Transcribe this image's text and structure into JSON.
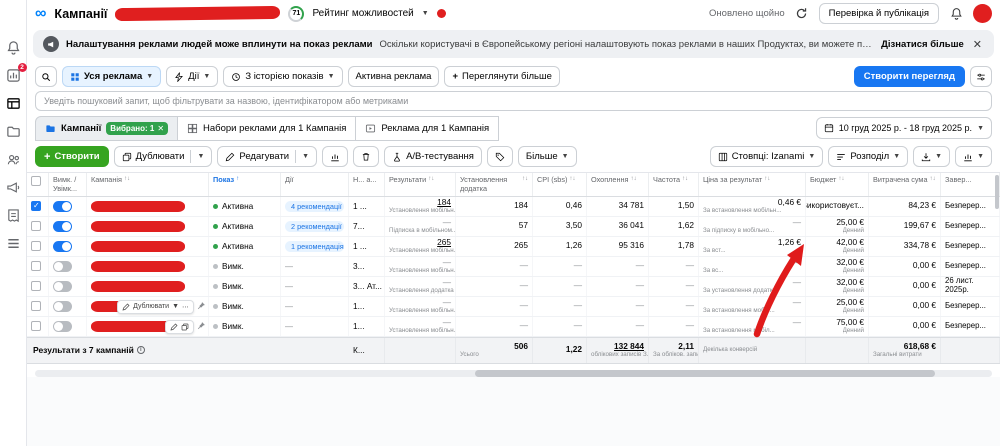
{
  "topbar": {
    "title": "Кампанії",
    "score": "71",
    "score_label": "Рейтинг можливостей",
    "updated": "Оновлено щойно",
    "review_button": "Перевірка й публікація"
  },
  "banner": {
    "title": "Налаштування реклами людей може вплинути на показ реклами",
    "text": "Оскільки користувачі в Європейському регіоні налаштовують показ реклами в наших Продуктах, ви можете помітити вплив на результативність, як-от зменшення охоплення. У деяких нов...",
    "link": "Дізнатися більше"
  },
  "filters": {
    "all_ads": "Уся реклама",
    "actions": "Дії",
    "history": "З історією показів",
    "active": "Активна реклама",
    "more": "Переглянути більше",
    "create_view": "Створити перегляд",
    "search_placeholder": "Уведіть пошуковий запит, щоб фільтрувати за назвою, ідентифікатором або метриками"
  },
  "tabs": {
    "campaigns": "Кампанії",
    "selected_badge": "Вибрано: 1",
    "adsets": "Набори реклами для 1 Кампанія",
    "ads": "Реклама для 1 Кампанія",
    "date_range": "10 груд 2025 р. - 18 груд 2025 р."
  },
  "toolbar": {
    "create": "Створити",
    "duplicate": "Дублювати",
    "edit": "Редагувати",
    "ab_test": "A/B-тестування",
    "more": "Більше",
    "columns": "Стовпці: Izanami",
    "breakdown": "Розподіл"
  },
  "row_tools": {
    "duplicate": "Дублювати"
  },
  "table": {
    "headers": {
      "off_on": "Вимк. / Увімк...",
      "campaign": "Кампанія",
      "delivery": "Показ",
      "actions": "Дії",
      "name_col": "Н... а...",
      "results": "Результати",
      "app_installs": "Установлення додатка",
      "cpi": "CPI (sbs)",
      "reach": "Охоплення",
      "frequency": "Частота",
      "cost_per_result": "Ціна за результат",
      "budget": "Бюджет",
      "amount_spent": "Витрачена сума",
      "ends": "Завер..."
    },
    "rows": [
      {
        "on": true,
        "checked": true,
        "status": "Активна",
        "rec": "4 рекомендації",
        "name_col": "1 ...",
        "result": "184",
        "result_sub": "Установлення мобільн...",
        "installs": "184",
        "cpi": "0,46",
        "reach": "34 781",
        "frequency": "1,50",
        "cost": "0,46 €",
        "cost_sub": "За встановлення мобільн...",
        "budget": "Використовуєт...",
        "budget_sub": "",
        "spent": "84,23 €",
        "ends": "Безперер..."
      },
      {
        "on": true,
        "checked": false,
        "status": "Активна",
        "rec": "2 рекомендації",
        "name_col": "7...",
        "result": "—",
        "result_sub": "Підписка в мобільном...",
        "installs": "57",
        "cpi": "3,50",
        "reach": "36 041",
        "frequency": "1,62",
        "cost": "—",
        "cost_sub": "За підписку в мобільно...",
        "budget": "25,00 €",
        "budget_sub": "Денний",
        "spent": "199,67 €",
        "ends": "Безперер..."
      },
      {
        "on": true,
        "checked": false,
        "status": "Активна",
        "rec": "1 рекомендація",
        "name_col": "1 ...",
        "result": "265",
        "result_sub": "Установлення мобільн...",
        "installs": "265",
        "cpi": "1,26",
        "reach": "95 316",
        "frequency": "1,78",
        "cost": "1,26 €",
        "cost_sub": "За вст...",
        "budget": "42,00 €",
        "budget_sub": "Денний",
        "spent": "334,78 €",
        "ends": "Безперер..."
      },
      {
        "on": false,
        "checked": false,
        "status": "Вимк.",
        "rec": "—",
        "name_col": "3...",
        "result": "—",
        "result_sub": "Установлення мобільн...",
        "installs": "—",
        "cpi": "—",
        "reach": "—",
        "frequency": "—",
        "cost": "—",
        "cost_sub": "За вс...",
        "budget": "32,00 €",
        "budget_sub": "Денний",
        "spent": "0,00 €",
        "ends": "Безперер..."
      },
      {
        "on": false,
        "checked": false,
        "status": "Вимк.",
        "rec": "—",
        "name_col": "3... Ат...",
        "result": "—",
        "result_sub": "Установлення додатка",
        "installs": "—",
        "cpi": "—",
        "reach": "—",
        "frequency": "—",
        "cost": "—",
        "cost_sub": "За установлення додатка",
        "budget": "32,00 €",
        "budget_sub": "Денний",
        "spent": "0,00 €",
        "ends": "26 лист. 2025р."
      },
      {
        "on": false,
        "checked": false,
        "status": "Вимк.",
        "rec": "—",
        "name_col": "1...",
        "result": "—",
        "result_sub": "Установлення мобільн...",
        "installs": "—",
        "cpi": "—",
        "reach": "—",
        "frequency": "—",
        "cost": "—",
        "cost_sub": "За встановлення мобіл...",
        "budget": "25,00 €",
        "budget_sub": "Денний",
        "spent": "0,00 €",
        "ends": "Безперер...",
        "tools": "full"
      },
      {
        "on": false,
        "checked": false,
        "status": "Вимк.",
        "rec": "—",
        "name_col": "1...",
        "result": "—",
        "result_sub": "Установлення мобільн...",
        "installs": "—",
        "cpi": "—",
        "reach": "—",
        "frequency": "—",
        "cost": "—",
        "cost_sub": "За встановлення мобіл...",
        "budget": "75,00 €",
        "budget_sub": "Денний",
        "spent": "0,00 €",
        "ends": "Безперер...",
        "tools": "mini"
      }
    ],
    "footer": {
      "label": "Результати з 7 кампаній",
      "name_col": "К...",
      "installs": "506",
      "installs_sub": "Усього",
      "cpi": "1,22",
      "reach": "132 844",
      "reach_sub": "облікових записів З...",
      "frequency": "2,11",
      "frequency_sub": "За обліков. записи...",
      "cost_sub": "Декілька конверсій",
      "spent": "618,68 €",
      "spent_sub": "Загальні витрати"
    }
  }
}
